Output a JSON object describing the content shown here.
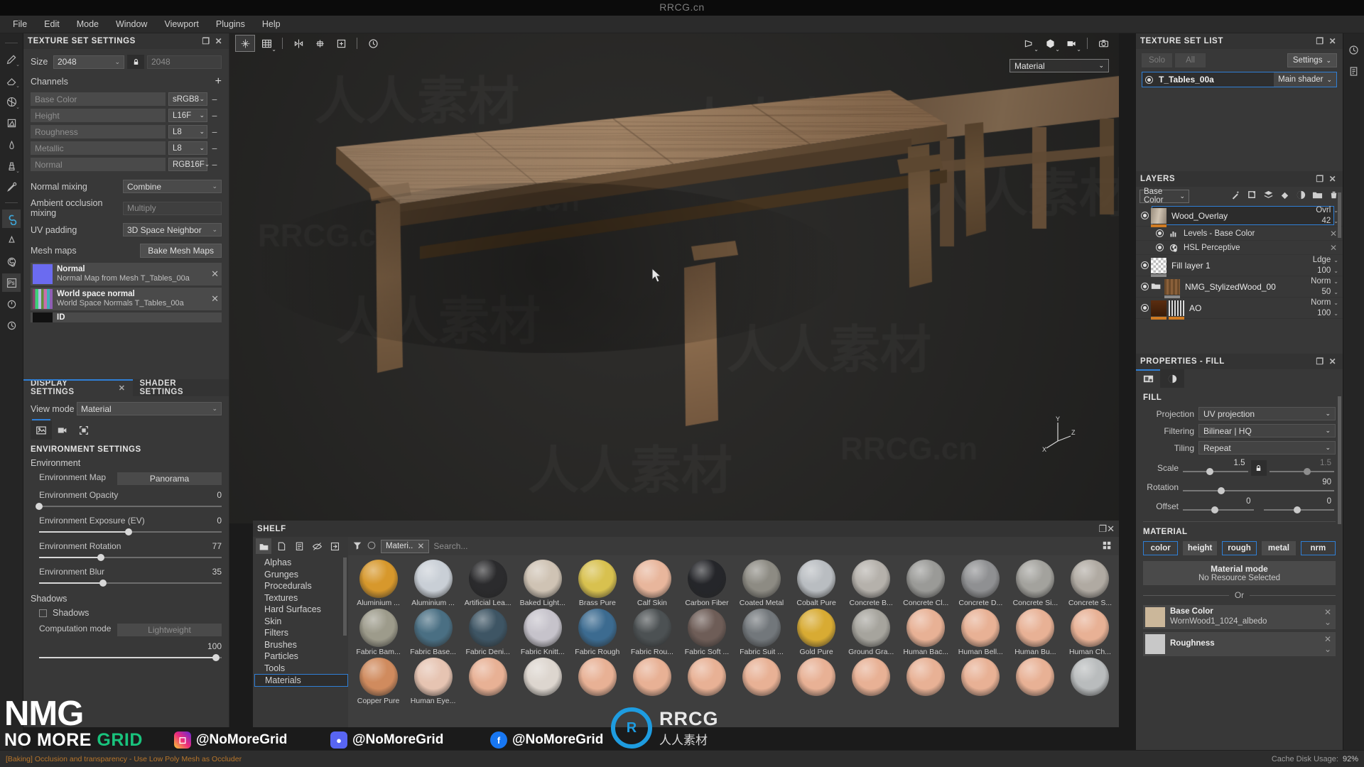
{
  "app": {
    "watermark_top": "RRCG.cn",
    "menu": [
      "File",
      "Edit",
      "Mode",
      "Window",
      "Viewport",
      "Plugins",
      "Help"
    ]
  },
  "texture_set_settings": {
    "title": "TEXTURE SET SETTINGS",
    "size_label": "Size",
    "size_value": "2048",
    "size_value_locked": "2048",
    "lock_icon": "lock-icon",
    "channels_label": "Channels",
    "add_channel_icon": "plus-icon",
    "channels": [
      {
        "name": "Base Color",
        "format": "sRGB8"
      },
      {
        "name": "Height",
        "format": "L16F"
      },
      {
        "name": "Roughness",
        "format": "L8"
      },
      {
        "name": "Metallic",
        "format": "L8"
      },
      {
        "name": "Normal",
        "format": "RGB16F"
      }
    ],
    "normal_mixing_label": "Normal mixing",
    "normal_mixing_value": "Combine",
    "ao_mixing_label": "Ambient occlusion mixing",
    "ao_mixing_value": "Multiply",
    "uv_padding_label": "UV padding",
    "uv_padding_value": "3D Space Neighbor",
    "mesh_maps_label": "Mesh maps",
    "bake_button": "Bake Mesh Maps",
    "mesh_maps": [
      {
        "title": "Normal",
        "subtitle": "Normal Map from Mesh T_Tables_00a"
      },
      {
        "title": "World space normal",
        "subtitle": "World Space Normals T_Tables_00a"
      },
      {
        "title": "ID",
        "subtitle": ""
      }
    ]
  },
  "display_settings": {
    "tabs": [
      {
        "label": "DISPLAY SETTINGS",
        "active": true,
        "closable": true
      },
      {
        "label": "SHADER SETTINGS",
        "active": false,
        "closable": false
      }
    ],
    "view_mode_label": "View mode",
    "view_mode_value": "Material",
    "view_icons": [
      "image-icon",
      "camera-icon",
      "fullscreen-icon"
    ],
    "section_title": "ENVIRONMENT SETTINGS",
    "environment_group": "Environment",
    "environment_map_label": "Environment Map",
    "environment_map_value": "Panorama",
    "sliders": [
      {
        "label": "Environment Opacity",
        "value": "0",
        "pct": 0
      },
      {
        "label": "Environment Exposure (EV)",
        "value": "0",
        "pct": 49
      },
      {
        "label": "Environment Rotation",
        "value": "77",
        "pct": 34
      },
      {
        "label": "Environment Blur",
        "value": "35",
        "pct": 35
      }
    ],
    "shadows_group": "Shadows",
    "shadows_checkbox_label": "Shadows",
    "shadows_checked": false,
    "computation_mode_label": "Computation mode",
    "computation_mode_value": "Lightweight",
    "last_slider_value": "100"
  },
  "viewport": {
    "toolbar_icons": [
      "transform-gizmo-icon",
      "grid-icon",
      "symmetry-icon",
      "symmetry-plane-icon",
      "add-plane-icon",
      "reset-camera-icon"
    ],
    "right_icons": [
      "perspective-icon",
      "cube-3d-icon",
      "camera-view-icon",
      "screenshot-icon"
    ],
    "material_selector": "Material",
    "axis_labels": {
      "x": "X",
      "y": "Y",
      "z": "Z"
    }
  },
  "shelf": {
    "title": "SHELF",
    "maximize_icon": "maximize-icon",
    "close_icon": "close-icon",
    "left_icons": [
      "folder-icon",
      "new-file-icon",
      "document-icon",
      "hidden-eye-icon",
      "import-icon"
    ],
    "categories": [
      "Alphas",
      "Grunges",
      "Procedurals",
      "Textures",
      "Hard Surfaces",
      "Skin",
      "Filters",
      "Brushes",
      "Particles",
      "Tools",
      "Materials"
    ],
    "selected_category": "Materials",
    "filter_icon": "filter-icon",
    "refresh_icon": "circle-icon",
    "active_chip": "Materi..",
    "search_placeholder": "Search...",
    "grid_view_icon": "grid-view-icon",
    "items": [
      {
        "label": "Aluminium ...",
        "color": "#d7982c"
      },
      {
        "label": "Aluminium ...",
        "color": "#c9cfd6"
      },
      {
        "label": "Artificial Lea...",
        "color": "#2b2b2d"
      },
      {
        "label": "Baked Light...",
        "color": "#cfc3b4"
      },
      {
        "label": "Brass Pure",
        "color": "#d8c14f"
      },
      {
        "label": "Calf Skin",
        "color": "#e8b69c"
      },
      {
        "label": "Carbon Fiber",
        "color": "#25262a"
      },
      {
        "label": "Coated Metal",
        "color": "#8d8b83"
      },
      {
        "label": "Cobalt Pure",
        "color": "#b9bdc1"
      },
      {
        "label": "Concrete B...",
        "color": "#b5b1ab"
      },
      {
        "label": "Concrete Cl...",
        "color": "#9a9a97"
      },
      {
        "label": "Concrete D...",
        "color": "#8f9092"
      },
      {
        "label": "Concrete Si...",
        "color": "#a3a29d"
      },
      {
        "label": "Concrete S...",
        "color": "#b0aaa2"
      },
      {
        "label": "Fabric Bam...",
        "color": "#9d9b8b"
      },
      {
        "label": "Fabric Base...",
        "color": "#4a6f83"
      },
      {
        "label": "Fabric Deni...",
        "color": "#3e5564"
      },
      {
        "label": "Fabric Knitt...",
        "color": "#c6c3cb"
      },
      {
        "label": "Fabric Rough",
        "color": "#3c6b90"
      },
      {
        "label": "Fabric Rou...",
        "color": "#4c5153"
      },
      {
        "label": "Fabric Soft ...",
        "color": "#6e5d57"
      },
      {
        "label": "Fabric Suit ...",
        "color": "#72777b"
      },
      {
        "label": "Gold Pure",
        "color": "#d8ab33"
      },
      {
        "label": "Ground Gra...",
        "color": "#a6a49d"
      },
      {
        "label": "Human Bac...",
        "color": "#e8b195"
      },
      {
        "label": "Human Bell...",
        "color": "#e8b195"
      },
      {
        "label": "Human Bu...",
        "color": "#e8b195"
      },
      {
        "label": "Human Ch...",
        "color": "#e8b195"
      },
      {
        "label": "Copper Pure",
        "color": "#d08b5e"
      },
      {
        "label": "Human Eye...",
        "color": "#e6c4b2"
      },
      {
        "label": "",
        "color": "#e8b195"
      },
      {
        "label": "",
        "color": "#ddd6cf"
      },
      {
        "label": "",
        "color": "#e8b195"
      },
      {
        "label": "",
        "color": "#e8b195"
      },
      {
        "label": "",
        "color": "#e8b195"
      },
      {
        "label": "",
        "color": "#e8b195"
      },
      {
        "label": "",
        "color": "#e8b195"
      },
      {
        "label": "",
        "color": "#e8b195"
      },
      {
        "label": "",
        "color": "#e8b195"
      },
      {
        "label": "",
        "color": "#e8b195"
      },
      {
        "label": "",
        "color": "#e8b195"
      },
      {
        "label": "",
        "color": "#b9bcbd"
      }
    ]
  },
  "texture_set_list": {
    "title": "TEXTURE SET LIST",
    "solo_button": "Solo",
    "all_button": "All",
    "settings_button": "Settings",
    "item_name": "T_Tables_00a",
    "item_shader": "Main shader"
  },
  "layers": {
    "title": "LAYERS",
    "channel_selector": "Base Color",
    "toolbar_icons": [
      "magic-wand-icon",
      "add-effect-icon",
      "add-layer-icon",
      "add-fill-layer-icon",
      "add-mask-icon",
      "add-folder-icon",
      "delete-icon"
    ],
    "items": [
      {
        "name": "Wood_Overlay",
        "blend": "Ovrl",
        "opacity": "42",
        "selected": true,
        "thumb": "wood-thumb",
        "ubar": "orange",
        "children": [
          {
            "name": "Levels - Base Color",
            "icon": "levels-icon"
          },
          {
            "name": "HSL Perceptive",
            "icon": "hsl-icon"
          }
        ]
      },
      {
        "name": "Fill layer 1",
        "blend": "Ldge",
        "opacity": "100",
        "selected": false,
        "thumb": "checker-thumb",
        "ubar": "grey",
        "children": []
      },
      {
        "name": "NMG_StylizedWood_00",
        "blend": "Norm",
        "opacity": "50",
        "selected": false,
        "thumb": "folder-wood-thumb",
        "ubar": "grey",
        "children": []
      },
      {
        "name": "AO",
        "blend": "Norm",
        "opacity": "100",
        "selected": false,
        "thumb": "ao-thumb",
        "ubar": "orange",
        "children": []
      }
    ]
  },
  "properties_fill": {
    "title": "PROPERTIES - FILL",
    "tabs": [
      "fill-properties-icon",
      "mask-properties-icon"
    ],
    "fill_section": "FILL",
    "projection_label": "Projection",
    "projection_value": "UV projection",
    "filtering_label": "Filtering",
    "filtering_value": "Bilinear | HQ",
    "tiling_label": "Tiling",
    "tiling_value": "Repeat",
    "scale_label": "Scale",
    "scale_u": "1.5",
    "scale_v": "1.5",
    "scale_lock_icon": "lock-icon",
    "rotation_label": "Rotation",
    "rotation_value": "90",
    "offset_label": "Offset",
    "offset_u": "0",
    "offset_v": "0",
    "material_section": "MATERIAL",
    "channel_buttons": [
      {
        "label": "color",
        "on": true
      },
      {
        "label": "height",
        "on": false
      },
      {
        "label": "rough",
        "on": true
      },
      {
        "label": "metal",
        "on": false
      },
      {
        "label": "nrm",
        "on": true
      }
    ],
    "material_mode_title": "Material mode",
    "material_mode_value": "No Resource Selected",
    "or_label": "Or",
    "slots": [
      {
        "title": "Base Color",
        "value": "WornWood1_1024_albedo",
        "thumb": "#cbb79a"
      },
      {
        "title": "Roughness",
        "value": "",
        "thumb": "#c8c8c8"
      }
    ]
  },
  "statusbar": {
    "hint": "[Baking] Occlusion and transparency - Use Low Poly Mesh as Occluder",
    "cache_label": "Cache Disk Usage:",
    "cache_value": "92%"
  },
  "overlay_branding": {
    "nmg_line1": "NMG",
    "nmg_line2_a": "NO MORE ",
    "nmg_line2_b": "GRID",
    "socials": [
      {
        "platform": "instagram-icon",
        "handle": "@NoMoreGrid",
        "color": "#d63384"
      },
      {
        "platform": "discord-icon",
        "handle": "@NoMoreGrid",
        "color": "#5865f2"
      },
      {
        "platform": "facebook-icon",
        "handle": "@NoMoreGrid",
        "color": "#1877f2"
      }
    ],
    "rrcg_text": "RRCG",
    "rrcg_sub": "人人素材"
  }
}
